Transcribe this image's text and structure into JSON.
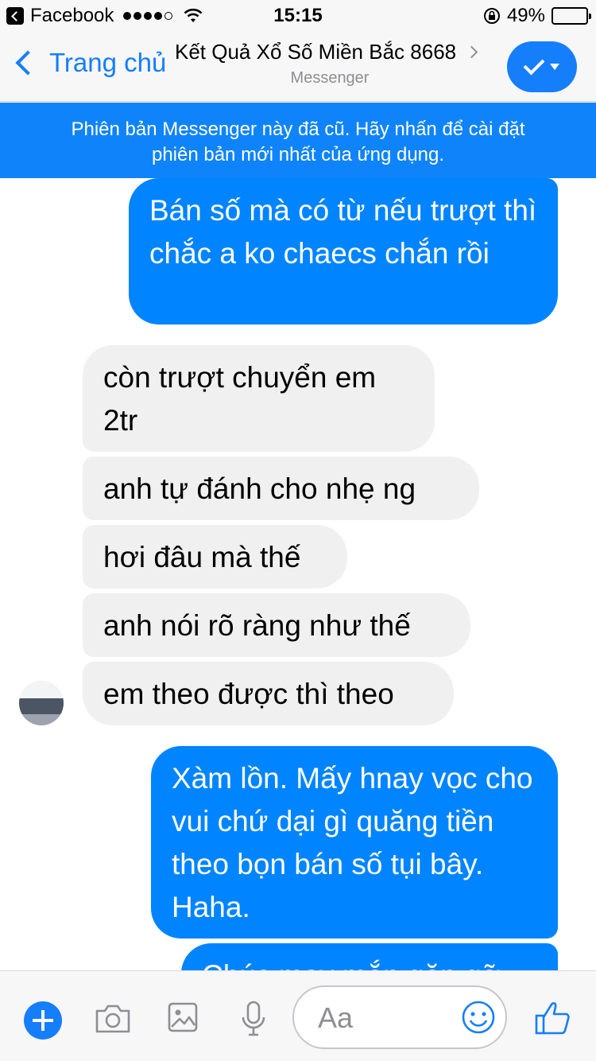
{
  "status_bar": {
    "back_app": "Facebook",
    "signal_icon": "signal-dots-icon",
    "time": "15:15",
    "battery_text": "49%",
    "battery_level": 0.49
  },
  "nav": {
    "back_label": "Trang chủ",
    "title": "Kết Quả Xổ Số Miền Bắc 8668",
    "subtitle": "Messenger"
  },
  "banner": {
    "line1": "Phiên bản Messenger này đã cũ. Hãy nhấn để cài đặt",
    "line2": "phiên bản mới nhất của ứng dụng."
  },
  "messages": [
    {
      "direction": "outgoing",
      "text": "Bán số mà có từ nếu trượt thì chắc a ko chaecs chắn rồi"
    },
    {
      "direction": "incoming",
      "text": "còn trượt chuyển em 2tr"
    },
    {
      "direction": "incoming",
      "text": "anh tự đánh cho nhẹ ng"
    },
    {
      "direction": "incoming",
      "text": "hơi đâu mà thế"
    },
    {
      "direction": "incoming",
      "text": "anh nói rõ ràng như thế"
    },
    {
      "direction": "incoming",
      "text": "em theo được thì theo"
    },
    {
      "direction": "outgoing",
      "text": "Xàm lồn. Mấy hnay vọc cho vui chứ dại gì quăng tiền theo bọn bán số tụi bây. Haha."
    },
    {
      "direction": "outgoing",
      "text": "Chúc may mắn gặp gỡ"
    }
  ],
  "composer": {
    "placeholder": "Aa",
    "icons": [
      "plus-icon",
      "camera-icon",
      "image-icon",
      "microphone-icon",
      "emoji-icon",
      "thumbs-up-icon"
    ]
  },
  "colors": {
    "accent": "#157efb",
    "outgoing_bubble": "#0084ff",
    "incoming_bubble": "#f1f0f0",
    "banner": "#0f84fa"
  }
}
